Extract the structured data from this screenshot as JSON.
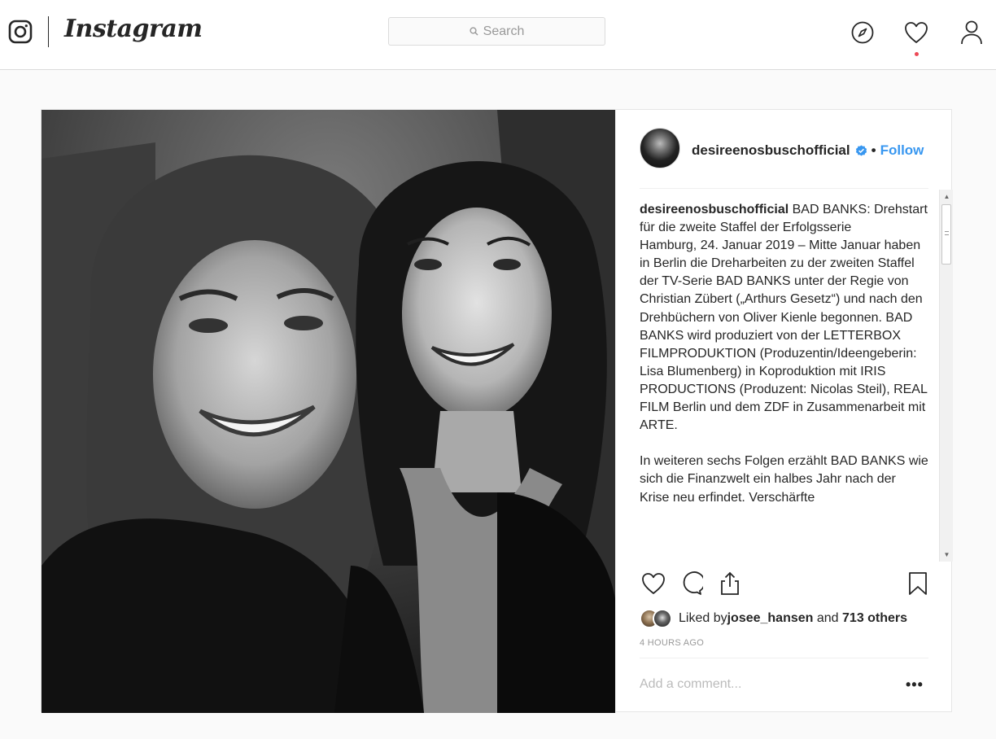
{
  "header": {
    "brand": "Instagram",
    "search_placeholder": "Search",
    "icons": [
      "camera-logo-icon",
      "explore-compass-icon",
      "activity-heart-icon",
      "profile-icon"
    ],
    "notification_dot_color": "#ed4956"
  },
  "post": {
    "username": "desireenosbuschofficial",
    "verified": true,
    "dot": "•",
    "follow_label": "Follow",
    "caption_user": "desireenosbuschofficial",
    "caption_text": " BAD BANKS: Drehstart für die zweite Staffel der Erfolgsserie\nHamburg, 24. Januar 2019 – Mitte Januar haben in Berlin die Dreharbeiten zu der zweiten Staffel der TV-Serie BAD BANKS unter der Regie von Christian Zübert („Arthurs Gesetz“) und nach den Drehbüchern von Oliver Kienle begonnen. BAD BANKS wird produziert von der LETTERBOX FILMPRODUKTION (Produzentin/Ideengeberin: Lisa Blumenberg) in Koproduktion mit IRIS PRODUCTIONS (Produzent: Nicolas Steil), REAL FILM Berlin und dem ZDF in Zusammenarbeit mit ARTE.\n\nIn weiteren sechs Folgen erzählt BAD BANKS wie sich die Finanzwelt ein halbes Jahr nach der Krise neu erfindet. Verschärfte",
    "likes_prefix": "Liked by ",
    "liked_by_user": "josee_hansen",
    "likes_and": " and ",
    "likes_others": "713 others",
    "timestamp": "4 HOURS AGO",
    "comment_placeholder": "Add a comment...",
    "more_label": "•••",
    "accent_color": "#3897f0"
  }
}
